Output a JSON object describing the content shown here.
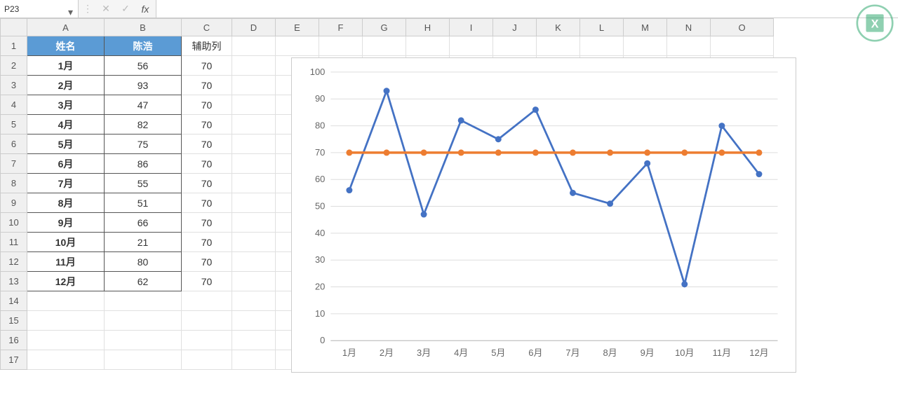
{
  "formula_bar": {
    "name_box": "P23",
    "cancel": "✕",
    "confirm": "✓",
    "fx": "fx",
    "value": ""
  },
  "columns": [
    "A",
    "B",
    "C",
    "D",
    "E",
    "F",
    "G",
    "H",
    "I",
    "J",
    "K",
    "L",
    "M",
    "N",
    "O"
  ],
  "rows_visible": 17,
  "table": {
    "headers": {
      "A": "姓名",
      "B": "陈浩",
      "C": "辅助列"
    },
    "data": [
      {
        "m": "1月",
        "v": 56,
        "aux": 70
      },
      {
        "m": "2月",
        "v": 93,
        "aux": 70
      },
      {
        "m": "3月",
        "v": 47,
        "aux": 70
      },
      {
        "m": "4月",
        "v": 82,
        "aux": 70
      },
      {
        "m": "5月",
        "v": 75,
        "aux": 70
      },
      {
        "m": "6月",
        "v": 86,
        "aux": 70
      },
      {
        "m": "7月",
        "v": 55,
        "aux": 70
      },
      {
        "m": "8月",
        "v": 51,
        "aux": 70
      },
      {
        "m": "9月",
        "v": 66,
        "aux": 70
      },
      {
        "m": "10月",
        "v": 21,
        "aux": 70
      },
      {
        "m": "11月",
        "v": 80,
        "aux": 70
      },
      {
        "m": "12月",
        "v": 62,
        "aux": 70
      }
    ]
  },
  "chart_data": {
    "type": "line",
    "categories": [
      "1月",
      "2月",
      "3月",
      "4月",
      "5月",
      "6月",
      "7月",
      "8月",
      "9月",
      "10月",
      "11月",
      "12月"
    ],
    "series": [
      {
        "name": "陈浩",
        "values": [
          56,
          93,
          47,
          82,
          75,
          86,
          55,
          51,
          66,
          21,
          80,
          62
        ],
        "color": "#4472C4"
      },
      {
        "name": "辅助列",
        "values": [
          70,
          70,
          70,
          70,
          70,
          70,
          70,
          70,
          70,
          70,
          70,
          70
        ],
        "color": "#ED7D31"
      }
    ],
    "ylim": [
      0,
      100
    ],
    "ytick_step": 10,
    "xlabel": "",
    "ylabel": "",
    "grid": true
  },
  "colors": {
    "header_bg": "#5B9BD5",
    "series1": "#4472C4",
    "series2": "#ED7D31"
  }
}
